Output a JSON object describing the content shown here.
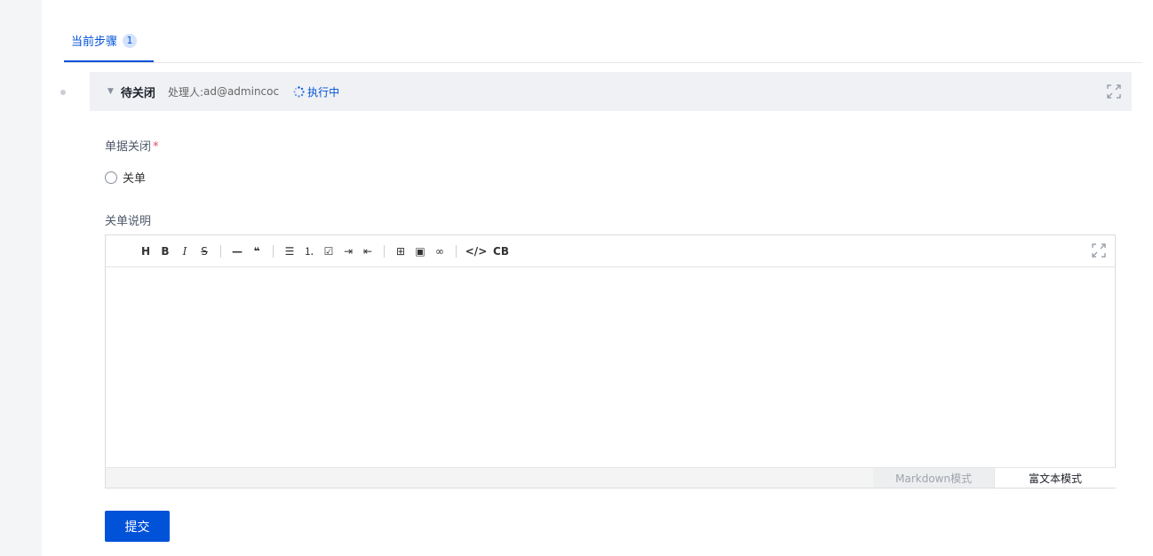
{
  "tabs": [
    {
      "label": "当前步骤",
      "badge": "1"
    }
  ],
  "step": {
    "title": "待关闭",
    "handler_label": "处理人:",
    "handler_value": "ad@admincoc",
    "status": "执行中",
    "status_color": "#0052d9"
  },
  "form": {
    "close_field": {
      "label": "单据关闭",
      "required_mark": "*",
      "option": "关单"
    },
    "desc_field": {
      "label": "关单说明"
    }
  },
  "editor": {
    "toolbar": [
      [
        "H",
        "B",
        "I",
        "S"
      ],
      [
        "—",
        "❝"
      ],
      [
        "☰",
        "⒈",
        "☑",
        "⇥",
        "⇤"
      ],
      [
        "⊞",
        "▣",
        "∞"
      ],
      [
        "</>",
        "CB"
      ]
    ],
    "toolbar_icons": [
      "heading",
      "bold",
      "italic",
      "strikethrough",
      "hr",
      "quote",
      "unordered-list",
      "ordered-list",
      "task-list",
      "indent",
      "outdent",
      "table",
      "image",
      "link",
      "code",
      "code-block"
    ],
    "mode_markdown": "Markdown模式",
    "mode_richtext": "富文本模式"
  },
  "submit_label": "提交",
  "colors": {
    "primary": "#0052d9",
    "required": "#e34d59"
  }
}
